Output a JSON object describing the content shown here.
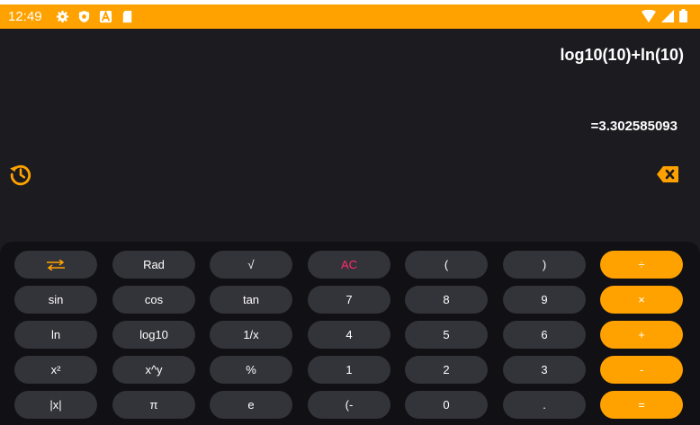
{
  "status_bar": {
    "time": "12:49",
    "icons": [
      "gear-icon",
      "shield-icon",
      "a-badge-icon",
      "sd-card-icon"
    ],
    "right_icons": [
      "wifi-icon",
      "signal-icon",
      "battery-icon"
    ]
  },
  "display": {
    "expression": "log10(10)+ln(10)",
    "result": "=3.302585093"
  },
  "colors": {
    "accent": "#ffa200",
    "background": "#1c1b1f",
    "keypad_background": "#111014",
    "key_background": "#33333a",
    "ac_text": "#ff2d6a"
  },
  "keys": {
    "swap": "⇄",
    "rad": "Rad",
    "sqrt": "√",
    "ac": "AC",
    "lparen": "(",
    "rparen": ")",
    "divide": "÷",
    "sin": "sin",
    "cos": "cos",
    "tan": "tan",
    "n7": "7",
    "n8": "8",
    "n9": "9",
    "multiply": "×",
    "ln": "ln",
    "log10": "log10",
    "inverse": "1/x",
    "n4": "4",
    "n5": "5",
    "n6": "6",
    "plus": "+",
    "square": "x²",
    "power": "x^y",
    "percent": "%",
    "n1": "1",
    "n2": "2",
    "n3": "3",
    "minus": "-",
    "abs": "|x|",
    "pi": "π",
    "e": "e",
    "negate": "(-",
    "n0": "0",
    "dot": ".",
    "equals": "="
  }
}
